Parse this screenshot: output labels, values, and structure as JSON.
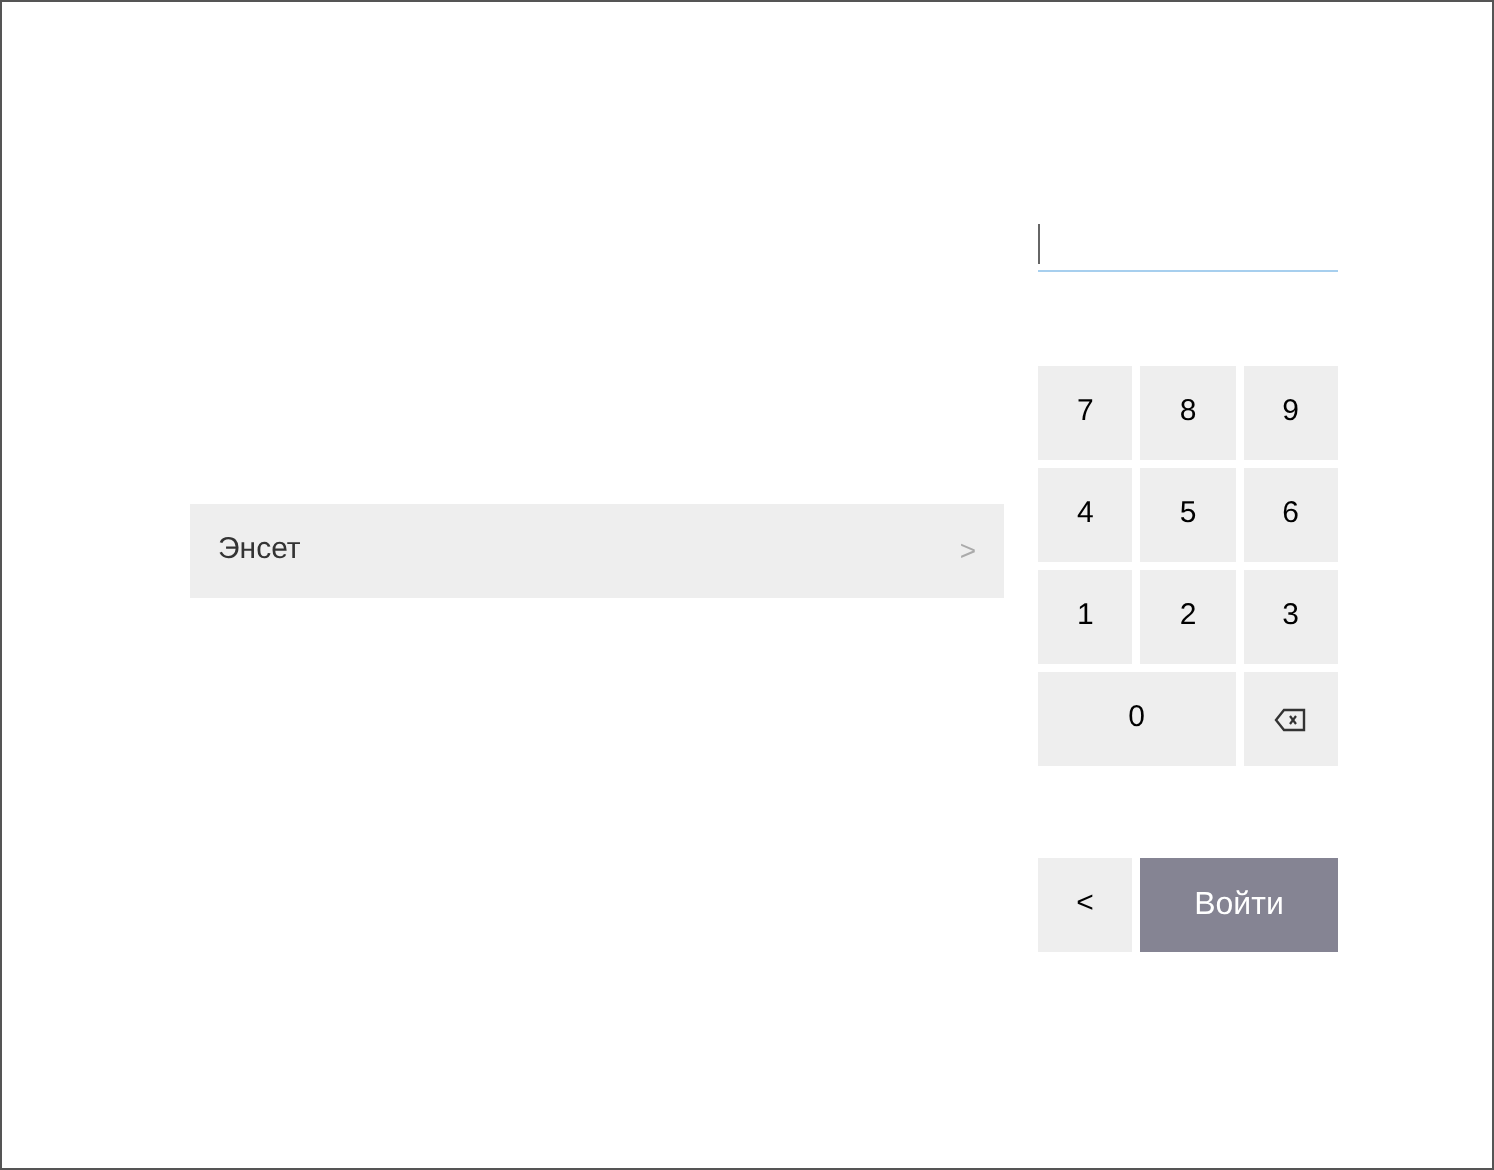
{
  "user_list": [
    {
      "name": "Энсет",
      "chevron": ">"
    }
  ],
  "pin_field": {
    "focused": true
  },
  "keypad": [
    {
      "kind": "digit",
      "label": "7",
      "wide": false
    },
    {
      "kind": "digit",
      "label": "8",
      "wide": false
    },
    {
      "kind": "digit",
      "label": "9",
      "wide": false
    },
    {
      "kind": "digit",
      "label": "4",
      "wide": false
    },
    {
      "kind": "digit",
      "label": "5",
      "wide": false
    },
    {
      "kind": "digit",
      "label": "6",
      "wide": false
    },
    {
      "kind": "digit",
      "label": "1",
      "wide": false
    },
    {
      "kind": "digit",
      "label": "2",
      "wide": false
    },
    {
      "kind": "digit",
      "label": "3",
      "wide": false
    },
    {
      "kind": "digit",
      "label": "0",
      "wide": true
    },
    {
      "kind": "backspace",
      "wide": false
    }
  ],
  "back_button": {
    "label": "<"
  },
  "login_button": {
    "label": "Войти"
  }
}
